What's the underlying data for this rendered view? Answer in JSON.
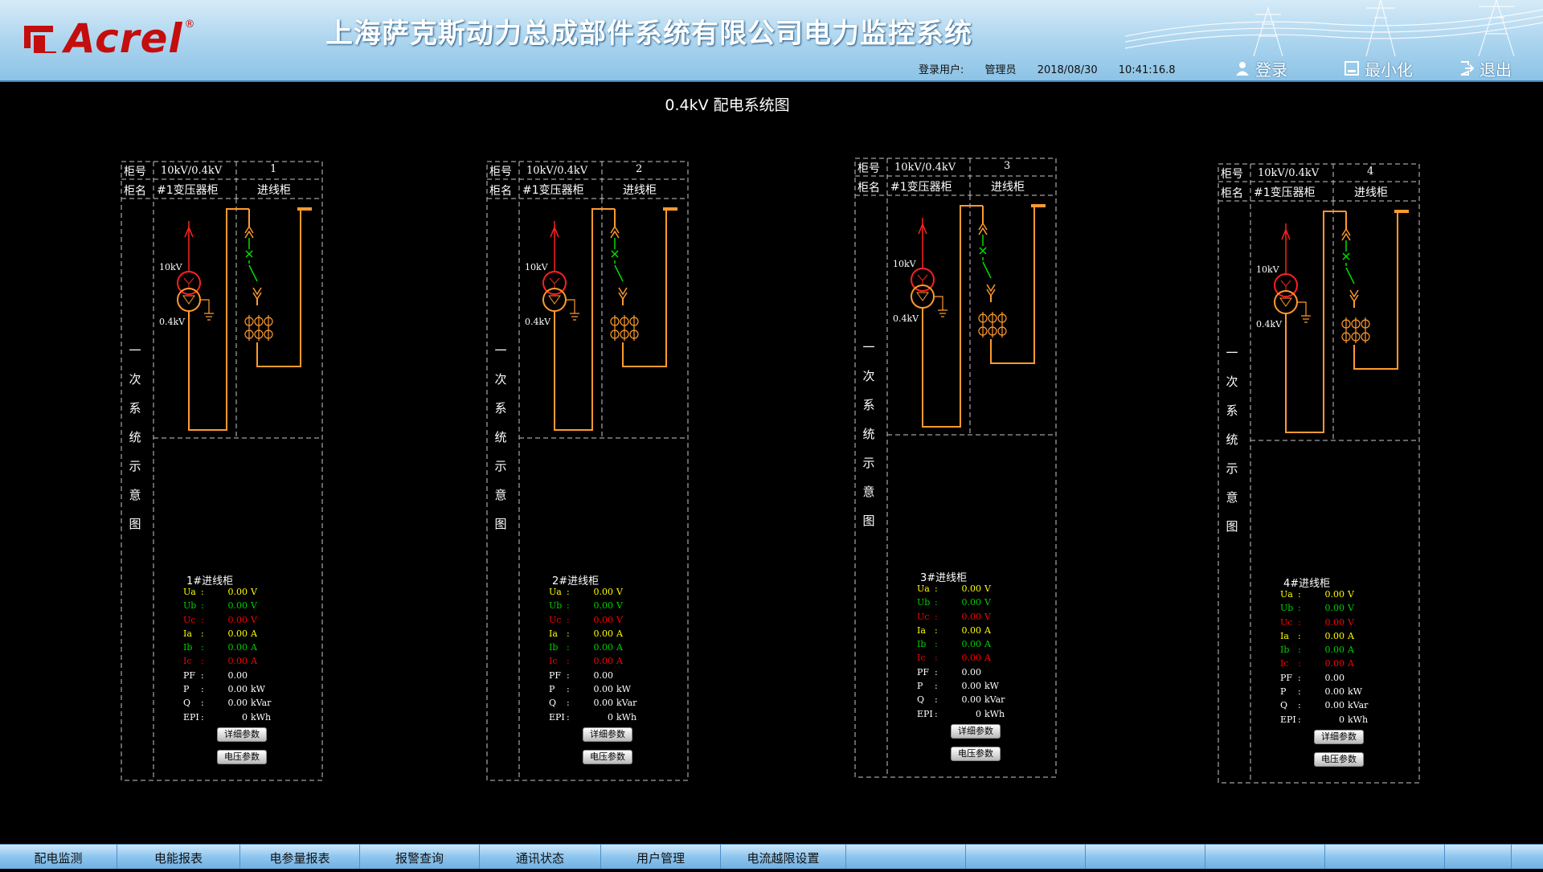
{
  "header": {
    "logo_text": "Acrel",
    "logo_reg": "®",
    "title": "上海萨克斯动力总成部件系统有限公司电力监控系统",
    "login_label": "登录用户:",
    "user": "管理员",
    "date": "2018/08/30",
    "time": "10:41:16.8",
    "buttons": {
      "login": "登录",
      "minimize": "最小化",
      "exit": "退出"
    }
  },
  "diagram_title": "0.4kV 配电系统图",
  "panels": [
    {
      "row1_label": "柜号",
      "voltage": "10kV/0.4kV",
      "number": "1",
      "row2_label": "柜名",
      "transformer": "#1变压器柜",
      "name": "进线柜",
      "vertical_label": "一次系统示意图",
      "hv": "10kV",
      "lv": "0.4kV",
      "meas_title": "1#进线柜",
      "meas": [
        {
          "label": "Ua",
          "value": "0.00",
          "unit": "V",
          "color": "#ffff00"
        },
        {
          "label": "Ub",
          "value": "0.00",
          "unit": "V",
          "color": "#00d000"
        },
        {
          "label": "Uc",
          "value": "0.00",
          "unit": "V",
          "color": "#ff0000"
        },
        {
          "label": "Ia",
          "value": "0.00",
          "unit": "A",
          "color": "#ffff00"
        },
        {
          "label": "Ib",
          "value": "0.00",
          "unit": "A",
          "color": "#00d000"
        },
        {
          "label": "Ic",
          "value": "0.00",
          "unit": "A",
          "color": "#ff0000"
        },
        {
          "label": "PF",
          "value": "0.00",
          "unit": "",
          "color": "#ffffff"
        },
        {
          "label": "P",
          "value": "0.00",
          "unit": "kW",
          "color": "#ffffff"
        },
        {
          "label": "Q",
          "value": "0.00",
          "unit": "kVar",
          "color": "#ffffff"
        },
        {
          "label": "EPI",
          "value": "0",
          "unit": "kWh",
          "color": "#ffffff"
        }
      ],
      "btn_detail": "详细参数",
      "btn_voltage": "电压参数"
    },
    {
      "row1_label": "柜号",
      "voltage": "10kV/0.4kV",
      "number": "2",
      "row2_label": "柜名",
      "transformer": "#1变压器柜",
      "name": "进线柜",
      "vertical_label": "一次系统示意图",
      "hv": "10kV",
      "lv": "0.4kV",
      "meas_title": "2#进线柜",
      "meas": [
        {
          "label": "Ua",
          "value": "0.00",
          "unit": "V",
          "color": "#ffff00"
        },
        {
          "label": "Ub",
          "value": "0.00",
          "unit": "V",
          "color": "#00d000"
        },
        {
          "label": "Uc",
          "value": "0.00",
          "unit": "V",
          "color": "#ff0000"
        },
        {
          "label": "Ia",
          "value": "0.00",
          "unit": "A",
          "color": "#ffff00"
        },
        {
          "label": "Ib",
          "value": "0.00",
          "unit": "A",
          "color": "#00d000"
        },
        {
          "label": "Ic",
          "value": "0.00",
          "unit": "A",
          "color": "#ff0000"
        },
        {
          "label": "PF",
          "value": "0.00",
          "unit": "",
          "color": "#ffffff"
        },
        {
          "label": "P",
          "value": "0.00",
          "unit": "kW",
          "color": "#ffffff"
        },
        {
          "label": "Q",
          "value": "0.00",
          "unit": "kVar",
          "color": "#ffffff"
        },
        {
          "label": "EPI",
          "value": "0",
          "unit": "kWh",
          "color": "#ffffff"
        }
      ],
      "btn_detail": "详细参数",
      "btn_voltage": "电压参数"
    },
    {
      "row1_label": "柜号",
      "voltage": "10kV/0.4kV",
      "number": "3",
      "row2_label": "柜名",
      "transformer": "#1变压器柜",
      "name": "进线柜",
      "vertical_label": "一次系统示意图",
      "hv": "10kV",
      "lv": "0.4kV",
      "meas_title": "3#进线柜",
      "meas": [
        {
          "label": "Ua",
          "value": "0.00",
          "unit": "V",
          "color": "#ffff00"
        },
        {
          "label": "Ub",
          "value": "0.00",
          "unit": "V",
          "color": "#00d000"
        },
        {
          "label": "Uc",
          "value": "0.00",
          "unit": "V",
          "color": "#ff0000"
        },
        {
          "label": "Ia",
          "value": "0.00",
          "unit": "A",
          "color": "#ffff00"
        },
        {
          "label": "Ib",
          "value": "0.00",
          "unit": "A",
          "color": "#00d000"
        },
        {
          "label": "Ic",
          "value": "0.00",
          "unit": "A",
          "color": "#ff0000"
        },
        {
          "label": "PF",
          "value": "0.00",
          "unit": "",
          "color": "#ffffff"
        },
        {
          "label": "P",
          "value": "0.00",
          "unit": "kW",
          "color": "#ffffff"
        },
        {
          "label": "Q",
          "value": "0.00",
          "unit": "kVar",
          "color": "#ffffff"
        },
        {
          "label": "EPI",
          "value": "0",
          "unit": "kWh",
          "color": "#ffffff"
        }
      ],
      "btn_detail": "详细参数",
      "btn_voltage": "电压参数"
    },
    {
      "row1_label": "柜号",
      "voltage": "10kV/0.4kV",
      "number": "4",
      "row2_label": "柜名",
      "transformer": "#1变压器柜",
      "name": "进线柜",
      "vertical_label": "一次系统示意图",
      "hv": "10kV",
      "lv": "0.4kV",
      "meas_title": "4#进线柜",
      "meas": [
        {
          "label": "Ua",
          "value": "0.00",
          "unit": "V",
          "color": "#ffff00"
        },
        {
          "label": "Ub",
          "value": "0.00",
          "unit": "V",
          "color": "#00d000"
        },
        {
          "label": "Uc",
          "value": "0.00",
          "unit": "V",
          "color": "#ff0000"
        },
        {
          "label": "Ia",
          "value": "0.00",
          "unit": "A",
          "color": "#ffff00"
        },
        {
          "label": "Ib",
          "value": "0.00",
          "unit": "A",
          "color": "#00d000"
        },
        {
          "label": "Ic",
          "value": "0.00",
          "unit": "A",
          "color": "#ff0000"
        },
        {
          "label": "PF",
          "value": "0.00",
          "unit": "",
          "color": "#ffffff"
        },
        {
          "label": "P",
          "value": "0.00",
          "unit": "kW",
          "color": "#ffffff"
        },
        {
          "label": "Q",
          "value": "0.00",
          "unit": "kVar",
          "color": "#ffffff"
        },
        {
          "label": "EPI",
          "value": "0",
          "unit": "kWh",
          "color": "#ffffff"
        }
      ],
      "btn_detail": "详细参数",
      "btn_voltage": "电压参数"
    }
  ],
  "nav": [
    "配电监测",
    "电能报表",
    "电参量报表",
    "报警查询",
    "通讯状态",
    "用户管理",
    "电流越限设置",
    "",
    "",
    "",
    "",
    "",
    ""
  ],
  "colors": {
    "busbar": "#ff9a2e",
    "hv": "#ff2020",
    "switch": "#00e000",
    "frame": "#c8c8c8"
  }
}
